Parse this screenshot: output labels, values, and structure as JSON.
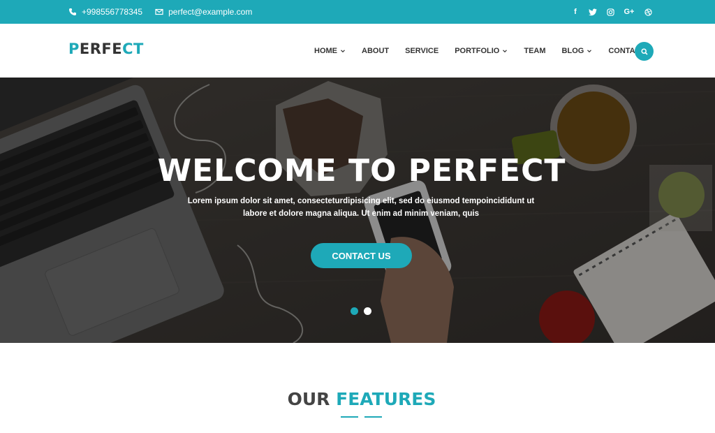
{
  "topbar": {
    "phone": "+998556778345",
    "email": "perfect@example.com",
    "social": [
      {
        "name": "facebook-icon",
        "glyph": "f"
      },
      {
        "name": "twitter-icon",
        "glyph": "t"
      },
      {
        "name": "instagram-icon",
        "glyph": "◎"
      },
      {
        "name": "google-plus-icon",
        "glyph": "G+"
      },
      {
        "name": "dribbble-icon",
        "glyph": "⊛"
      }
    ]
  },
  "header": {
    "logo_part1": "PERF",
    "logo_part2": "E",
    "logo_part3": "CT",
    "nav": [
      {
        "label": "HOME",
        "dropdown": true
      },
      {
        "label": "ABOUT",
        "dropdown": false
      },
      {
        "label": "SERVICE",
        "dropdown": false
      },
      {
        "label": "PORTFOLIO",
        "dropdown": true
      },
      {
        "label": "TEAM",
        "dropdown": false
      },
      {
        "label": "BLOG",
        "dropdown": true
      },
      {
        "label": "CONTACT",
        "dropdown": false
      }
    ]
  },
  "hero": {
    "title": "WELCOME TO PERFECT",
    "text_line1": "Lorem ipsum dolor sit amet, consecteturdipisicing elit, sed do eiusmod tempoincididunt ut",
    "text_line2": "labore et dolore magna aliqua. Ut enim ad minim veniam, quis",
    "button": "CONTACT US",
    "slides": 2,
    "active_slide": 1
  },
  "features": {
    "title_dark": "OUR",
    "title_accent": "FEATURES"
  },
  "colors": {
    "accent": "#1ea9b8",
    "text_dark": "#333333"
  }
}
